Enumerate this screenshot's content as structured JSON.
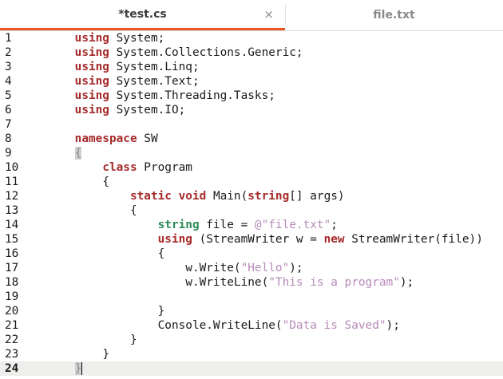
{
  "tabs": [
    {
      "label": "*test.cs",
      "active": true,
      "close_glyph": "×"
    },
    {
      "label": "file.txt",
      "active": false
    }
  ],
  "accent_color": "#e95420",
  "editor": {
    "current_line": 24,
    "lines": [
      {
        "n": "1",
        "indent": "    ",
        "segs": [
          {
            "t": "using",
            "c": "kw"
          },
          {
            "t": " System;"
          }
        ]
      },
      {
        "n": "2",
        "indent": "    ",
        "segs": [
          {
            "t": "using",
            "c": "kw"
          },
          {
            "t": " System.Collections.Generic;"
          }
        ]
      },
      {
        "n": "3",
        "indent": "    ",
        "segs": [
          {
            "t": "using",
            "c": "kw"
          },
          {
            "t": " System.Linq;"
          }
        ]
      },
      {
        "n": "4",
        "indent": "    ",
        "segs": [
          {
            "t": "using",
            "c": "kw"
          },
          {
            "t": " System.Text;"
          }
        ]
      },
      {
        "n": "5",
        "indent": "    ",
        "segs": [
          {
            "t": "using",
            "c": "kw"
          },
          {
            "t": " System.Threading.Tasks;"
          }
        ]
      },
      {
        "n": "6",
        "indent": "    ",
        "segs": [
          {
            "t": "using",
            "c": "kw"
          },
          {
            "t": " System.IO;"
          }
        ]
      },
      {
        "n": "7",
        "indent": "",
        "segs": []
      },
      {
        "n": "8",
        "indent": "    ",
        "segs": [
          {
            "t": "namespace",
            "c": "kw"
          },
          {
            "t": " SW"
          }
        ]
      },
      {
        "n": "9",
        "indent": "    ",
        "segs": [
          {
            "t": "{",
            "c": "caretbox"
          }
        ]
      },
      {
        "n": "10",
        "indent": "        ",
        "segs": [
          {
            "t": "class",
            "c": "kw"
          },
          {
            "t": " Program"
          }
        ]
      },
      {
        "n": "11",
        "indent": "        ",
        "segs": [
          {
            "t": "{"
          }
        ]
      },
      {
        "n": "12",
        "indent": "            ",
        "segs": [
          {
            "t": "static",
            "c": "kw"
          },
          {
            "t": " "
          },
          {
            "t": "void",
            "c": "kw"
          },
          {
            "t": " Main("
          },
          {
            "t": "string",
            "c": "kw"
          },
          {
            "t": "[] args)"
          }
        ]
      },
      {
        "n": "13",
        "indent": "            ",
        "segs": [
          {
            "t": "{"
          }
        ]
      },
      {
        "n": "14",
        "indent": "                ",
        "segs": [
          {
            "t": "string",
            "c": "ty"
          },
          {
            "t": " file = "
          },
          {
            "t": "@\"file.txt\"",
            "c": "str"
          },
          {
            "t": ";"
          }
        ]
      },
      {
        "n": "15",
        "indent": "                ",
        "segs": [
          {
            "t": "using",
            "c": "kw"
          },
          {
            "t": " (StreamWriter w = "
          },
          {
            "t": "new",
            "c": "kw"
          },
          {
            "t": " StreamWriter(file))"
          }
        ]
      },
      {
        "n": "16",
        "indent": "                ",
        "segs": [
          {
            "t": "{"
          }
        ]
      },
      {
        "n": "17",
        "indent": "                    ",
        "segs": [
          {
            "t": "w.Write("
          },
          {
            "t": "\"Hello\"",
            "c": "str"
          },
          {
            "t": ");"
          }
        ]
      },
      {
        "n": "18",
        "indent": "                    ",
        "segs": [
          {
            "t": "w.WriteLine("
          },
          {
            "t": "\"This is a program\"",
            "c": "str"
          },
          {
            "t": ");"
          }
        ]
      },
      {
        "n": "19",
        "indent": "",
        "segs": []
      },
      {
        "n": "20",
        "indent": "                ",
        "segs": [
          {
            "t": "}"
          }
        ]
      },
      {
        "n": "21",
        "indent": "                ",
        "segs": [
          {
            "t": "Console.WriteLine("
          },
          {
            "t": "\"Data is Saved\"",
            "c": "str"
          },
          {
            "t": ");"
          }
        ]
      },
      {
        "n": "22",
        "indent": "            ",
        "segs": [
          {
            "t": "}"
          }
        ]
      },
      {
        "n": "23",
        "indent": "        ",
        "segs": [
          {
            "t": "}"
          }
        ]
      },
      {
        "n": "24",
        "indent": "    ",
        "segs": [
          {
            "t": "}",
            "c": "caretbox"
          }
        ]
      }
    ]
  }
}
